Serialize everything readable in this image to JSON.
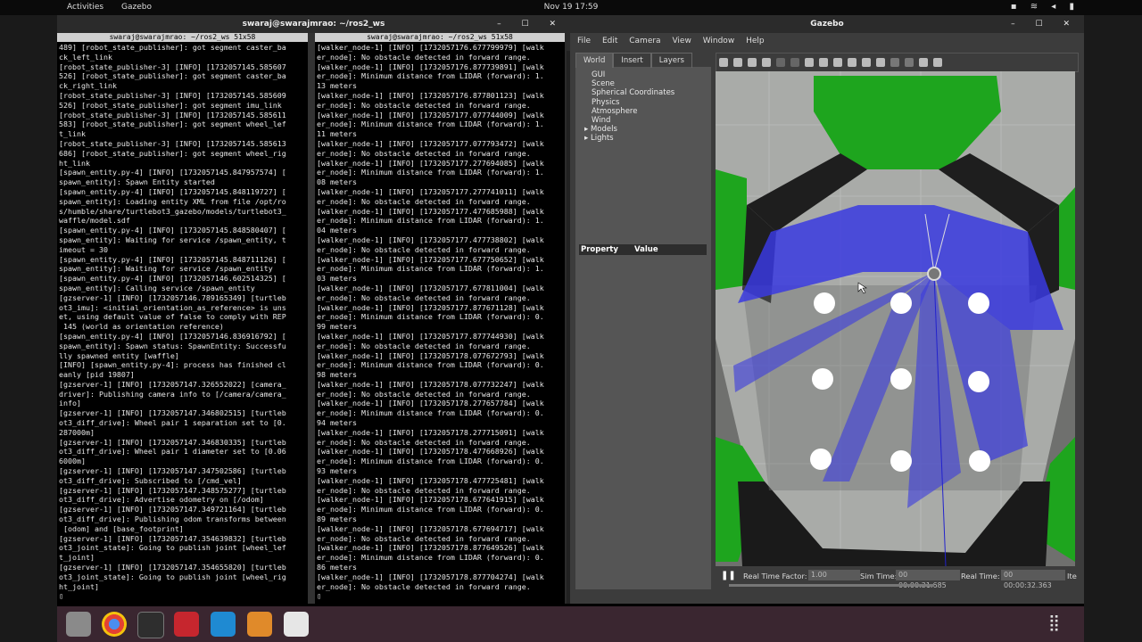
{
  "topbar": {
    "activities": "Activities",
    "app": "Gazebo",
    "clock": "Nov 19  17:59"
  },
  "terminal": {
    "title": "swaraj@swarajmrao: ~/ros2_ws",
    "pane1_title": "swaraj@swarajmrao: ~/ros2_ws 51x58",
    "pane2_title": "swaraj@swarajmrao: ~/ros2_ws 51x58",
    "pane1_log": "489] [robot_state_publisher]: got segment caster_ba\nck_left_link\n[robot_state_publisher-3] [INFO] [1732057145.585607\n526] [robot_state_publisher]: got segment caster_ba\nck_right_link\n[robot_state_publisher-3] [INFO] [1732057145.585609\n526] [robot_state_publisher]: got segment imu_link\n[robot_state_publisher-3] [INFO] [1732057145.585611\n583] [robot_state_publisher]: got segment wheel_lef\nt_link\n[robot_state_publisher-3] [INFO] [1732057145.585613\n686] [robot_state_publisher]: got segment wheel_rig\nht_link\n[spawn_entity.py-4] [INFO] [1732057145.847957574] [\nspawn_entity]: Spawn Entity started\n[spawn_entity.py-4] [INFO] [1732057145.848119727] [\nspawn_entity]: Loading entity XML from file /opt/ro\ns/humble/share/turtlebot3_gazebo/models/turtlebot3_\nwaffle/model.sdf\n[spawn_entity.py-4] [INFO] [1732057145.848580407] [\nspawn_entity]: Waiting for service /spawn_entity, t\nimeout = 30\n[spawn_entity.py-4] [INFO] [1732057145.848711126] [\nspawn_entity]: Waiting for service /spawn_entity\n[spawn_entity.py-4] [INFO] [1732057146.602514325] [\nspawn_entity]: Calling service /spawn_entity\n[gzserver-1] [INFO] [1732057146.789165349] [turtleb\not3_imu]: <initial_orientation_as_reference> is uns\net, using default value of false to comply with REP\n 145 (world as orientation reference)\n[spawn_entity.py-4] [INFO] [1732057146.836916792] [\nspawn_entity]: Spawn status: SpawnEntity: Successfu\nlly spawned entity [waffle]\n[INFO] [spawn_entity.py-4]: process has finished cl\neanly [pid 19807]\n[gzserver-1] [INFO] [1732057147.326552022] [camera_\ndriver]: Publishing camera info to [/camera/camera_\ninfo]\n[gzserver-1] [INFO] [1732057147.346802515] [turtleb\not3_diff_drive]: Wheel pair 1 separation set to [0.\n287000m]\n[gzserver-1] [INFO] [1732057147.346830335] [turtleb\not3_diff_drive]: Wheel pair 1 diameter set to [0.06\n6000m]\n[gzserver-1] [INFO] [1732057147.347502586] [turtleb\not3_diff_drive]: Subscribed to [/cmd_vel]\n[gzserver-1] [INFO] [1732057147.348575277] [turtleb\not3_diff_drive]: Advertise odometry on [/odom]\n[gzserver-1] [INFO] [1732057147.349721164] [turtleb\not3_diff_drive]: Publishing odom transforms between\n [odom] and [base_footprint]\n[gzserver-1] [INFO] [1732057147.354639832] [turtleb\not3_joint_state]: Going to publish joint [wheel_lef\nt_joint]\n[gzserver-1] [INFO] [1732057147.354655820] [turtleb\not3_joint_state]: Going to publish joint [wheel_rig\nht_joint]\n▯",
    "pane2_log": "[walker_node-1] [INFO] [1732057176.677799979] [walk\ner_node]: No obstacle detected in forward range.\n[walker_node-1] [INFO] [1732057176.877739891] [walk\ner_node]: Minimum distance from LIDAR (forward): 1.\n13 meters\n[walker_node-1] [INFO] [1732057176.877801123] [walk\ner_node]: No obstacle detected in forward range.\n[walker_node-1] [INFO] [1732057177.077744009] [walk\ner_node]: Minimum distance from LIDAR (forward): 1.\n11 meters\n[walker_node-1] [INFO] [1732057177.077793472] [walk\ner_node]: No obstacle detected in forward range.\n[walker_node-1] [INFO] [1732057177.277694085] [walk\ner_node]: Minimum distance from LIDAR (forward): 1.\n08 meters\n[walker_node-1] [INFO] [1732057177.277741011] [walk\ner_node]: No obstacle detected in forward range.\n[walker_node-1] [INFO] [1732057177.477685988] [walk\ner_node]: Minimum distance from LIDAR (forward): 1.\n04 meters\n[walker_node-1] [INFO] [1732057177.477738802] [walk\ner_node]: No obstacle detected in forward range.\n[walker_node-1] [INFO] [1732057177.677750652] [walk\ner_node]: Minimum distance from LIDAR (forward): 1.\n03 meters\n[walker_node-1] [INFO] [1732057177.677811004] [walk\ner_node]: No obstacle detected in forward range.\n[walker_node-1] [INFO] [1732057177.877671128] [walk\ner_node]: Minimum distance from LIDAR (forward): 0.\n99 meters\n[walker_node-1] [INFO] [1732057177.877744930] [walk\ner_node]: No obstacle detected in forward range.\n[walker_node-1] [INFO] [1732057178.077672793] [walk\ner_node]: Minimum distance from LIDAR (forward): 0.\n98 meters\n[walker_node-1] [INFO] [1732057178.077732247] [walk\ner_node]: No obstacle detected in forward range.\n[walker_node-1] [INFO] [1732057178.277657784] [walk\ner_node]: Minimum distance from LIDAR (forward): 0.\n94 meters\n[walker_node-1] [INFO] [1732057178.277715091] [walk\ner_node]: No obstacle detected in forward range.\n[walker_node-1] [INFO] [1732057178.477668926] [walk\ner_node]: Minimum distance from LIDAR (forward): 0.\n93 meters\n[walker_node-1] [INFO] [1732057178.477725481] [walk\ner_node]: No obstacle detected in forward range.\n[walker_node-1] [INFO] [1732057178.677641915] [walk\ner_node]: Minimum distance from LIDAR (forward): 0.\n89 meters\n[walker_node-1] [INFO] [1732057178.677694717] [walk\ner_node]: No obstacle detected in forward range.\n[walker_node-1] [INFO] [1732057178.877649526] [walk\ner_node]: Minimum distance from LIDAR (forward): 0.\n86 meters\n[walker_node-1] [INFO] [1732057178.877704274] [walk\ner_node]: No obstacle detected in forward range.\n▯"
  },
  "gazebo": {
    "title": "Gazebo",
    "menu": [
      "File",
      "Edit",
      "Camera",
      "View",
      "Window",
      "Help"
    ],
    "tabs": [
      "World",
      "Insert",
      "Layers"
    ],
    "tree": [
      "GUI",
      "Scene",
      "Spherical Coordinates",
      "Physics",
      "Atmosphere",
      "Wind",
      "Models",
      "Lights"
    ],
    "prop_header": {
      "property": "Property",
      "value": "Value"
    },
    "status": {
      "rtf_label": "Real Time Factor:",
      "rtf_value": "1.00",
      "sim_label": "Sim Time:",
      "sim_value": "00 00:00:31.685",
      "real_label": "Real Time:",
      "real_value": "00 00:00:32.363",
      "iter_label": "Ite"
    }
  }
}
